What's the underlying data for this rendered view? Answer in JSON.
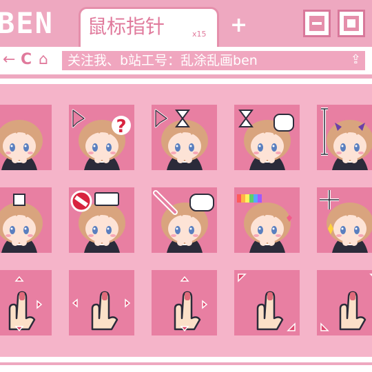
{
  "brand": "BEN",
  "tab": {
    "title": "鼠标指针",
    "count": "x15"
  },
  "new_tab_label": "+",
  "toolbar": {
    "back": "←",
    "reload": "C",
    "home": "⌂",
    "address": "关注我、b站工号：乱涂乱画ben"
  },
  "icons": {
    "min": "minimize-icon",
    "max": "maximize-icon",
    "share": "share-icon"
  },
  "grid": [
    {
      "name": "cursor-normal-select",
      "overlay": "chibi"
    },
    {
      "name": "cursor-help-select",
      "overlay": "question"
    },
    {
      "name": "cursor-working-in-background",
      "overlay": "hourglass-arrow"
    },
    {
      "name": "cursor-busy",
      "overlay": "hourglass-bubble"
    },
    {
      "name": "cursor-text-select",
      "overlay": "ibeam-horns"
    },
    {
      "name": "cursor-handwriting",
      "overlay": "pen"
    },
    {
      "name": "cursor-unavailable",
      "overlay": "no-sign"
    },
    {
      "name": "cursor-pen",
      "overlay": "pen-bubble"
    },
    {
      "name": "cursor-link-select",
      "overlay": "rainbow"
    },
    {
      "name": "cursor-precision-select",
      "overlay": "crosshair"
    },
    {
      "name": "cursor-vertical-resize",
      "overlay": "hand-vertical"
    },
    {
      "name": "cursor-horizontal-resize",
      "overlay": "hand-horizontal"
    },
    {
      "name": "cursor-move",
      "overlay": "hand-move"
    },
    {
      "name": "cursor-diagonal-resize-1",
      "overlay": "hand-diag1"
    },
    {
      "name": "cursor-diagonal-resize-2",
      "overlay": "hand-diag2"
    }
  ],
  "colors": {
    "accent": "#e87fa2",
    "bar": "#eea8c0",
    "panel": "#f5b4c9",
    "hair": "#d9a47e",
    "eye": "#5a7fbf",
    "dark": "#2b2b3a"
  }
}
